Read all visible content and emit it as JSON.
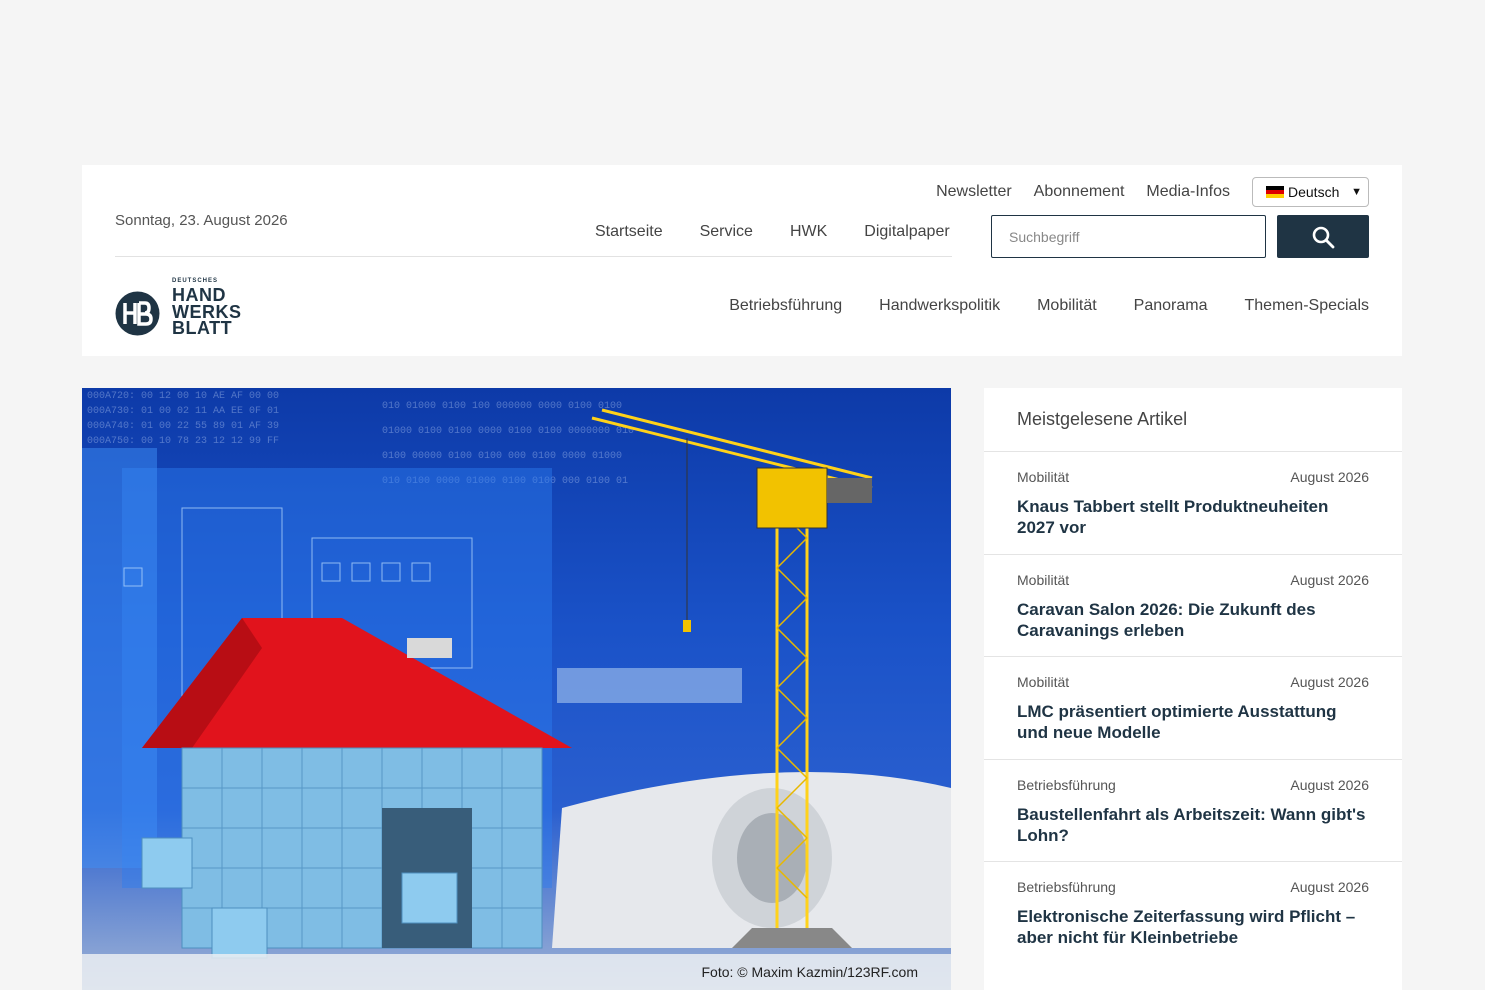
{
  "header": {
    "date": "Sonntag, 23. August 2026",
    "top_links": [
      "Newsletter",
      "Abonnement",
      "Media-Infos"
    ],
    "language": "Deutsch",
    "main_nav": [
      "Startseite",
      "Service",
      "HWK",
      "Digitalpaper"
    ],
    "search_placeholder": "Suchbegriff",
    "logo": {
      "small": "DEUTSCHES",
      "line1": "HAND",
      "line2": "WERKS",
      "line3": "BLATT"
    },
    "category_nav": [
      "Betriebsführung",
      "Handwerkspolitik",
      "Mobilität",
      "Panorama",
      "Themen-Specials"
    ]
  },
  "hero": {
    "caption": "Foto: © Maxim Kazmin/123RF.com"
  },
  "sidebar": {
    "title": "Meistgelesene Artikel",
    "articles": [
      {
        "category": "Mobilität",
        "date": "August 2026",
        "title": "Knaus Tabbert stellt Produktneuheiten 2027 vor"
      },
      {
        "category": "Mobilität",
        "date": "August 2026",
        "title": "Caravan Salon 2026: Die Zukunft des Caravanings erleben"
      },
      {
        "category": "Mobilität",
        "date": "August 2026",
        "title": "LMC präsentiert optimierte Ausstattung und neue Modelle"
      },
      {
        "category": "Betriebsführung",
        "date": "August 2026",
        "title": "Baustellenfahrt als Arbeitszeit: Wann gibt's Lohn?"
      },
      {
        "category": "Betriebsführung",
        "date": "August 2026",
        "title": "Elektronische Zeiterfassung wird Pflicht – aber nicht für Kleinbetriebe"
      }
    ]
  }
}
